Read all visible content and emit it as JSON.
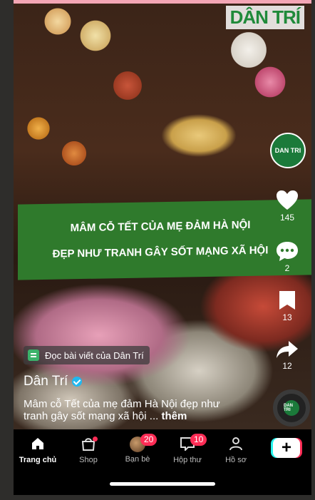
{
  "video": {
    "logo_text": "DÂN TRÍ",
    "headline_line1": "MÂM CỖ TẾT CỦA MẸ ĐẢM HÀ NỘI",
    "headline_line2": "ĐẸP NHƯ TRANH GÂY SỐT MẠNG XÃ HỘI"
  },
  "sidebar": {
    "avatar_label": "DAN TRI",
    "like_count": "145",
    "comment_count": "2",
    "bookmark_count": "13",
    "share_count": "12",
    "disc_label": "DAN TRI"
  },
  "post": {
    "read_more_label": "Đọc bài viết của Dân Trí",
    "author": "Dân Trí",
    "caption": "Mâm cỗ Tết của mẹ đảm Hà Nội đẹp như tranh gây sốt mạng xã hội ...",
    "more_label": "thêm"
  },
  "navbar": {
    "items": [
      {
        "label": "Trang chủ"
      },
      {
        "label": "Shop"
      },
      {
        "label": "Bạn bè",
        "badge": "20"
      },
      {
        "label": "Hộp thư",
        "badge": "10"
      },
      {
        "label": "Hồ sơ"
      }
    ],
    "create_label": "+"
  }
}
